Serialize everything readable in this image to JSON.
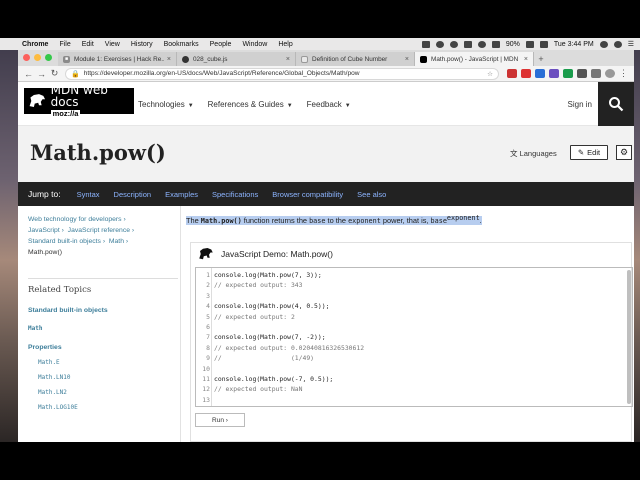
{
  "menubar": {
    "app": "Chrome",
    "items": [
      "File",
      "Edit",
      "View",
      "History",
      "Bookmarks",
      "People",
      "Window",
      "Help"
    ],
    "battery": "90%",
    "clock": "Tue 3:44 PM"
  },
  "tabs": [
    {
      "title": "Module 1: Exercises | Hack Re...",
      "icon": "hackreactor-icon"
    },
    {
      "title": "028_cube.js",
      "icon": "github-icon"
    },
    {
      "title": "Definition of Cube Number",
      "icon": "page-icon"
    },
    {
      "title": "Math.pow() - JavaScript | MDN",
      "icon": "mdn-icon"
    }
  ],
  "address": {
    "url": "https://developer.mozilla.org/en-US/docs/Web/JavaScript/Reference/Global_Objects/Math/pow"
  },
  "header": {
    "logo_line1": "MDN web docs",
    "logo_line2": "moz://a",
    "nav": [
      "Technologies",
      "References & Guides",
      "Feedback"
    ],
    "signin": "Sign in"
  },
  "title": {
    "h1": "Math.pow()",
    "languages": "Languages",
    "edit": "Edit"
  },
  "jump": {
    "label": "Jump to:",
    "items": [
      "Syntax",
      "Description",
      "Examples",
      "Specifications",
      "Browser compatibility",
      "See also"
    ]
  },
  "sidebar": {
    "breadcrumbs": [
      "Web technology for developers",
      "JavaScript",
      "JavaScript reference",
      "Standard built-in objects",
      "Math",
      "Math.pow()"
    ],
    "related": "Related Topics",
    "std": "Standard built-in objects",
    "math": "Math",
    "properties": "Properties",
    "props": [
      "Math.E",
      "Math.LN10",
      "Math.LN2",
      "Math.LOG10E"
    ]
  },
  "article": {
    "intro_1": "The ",
    "intro_fn": "Math.pow()",
    "intro_2": " function returns the ",
    "intro_base": "base",
    "intro_3": " to the ",
    "intro_exp": "exponent",
    "intro_4": " power, that is, ",
    "intro_base2": "base",
    "intro_sup": "exponent",
    "intro_5": "."
  },
  "demo": {
    "title": "JavaScript Demo: Math.pow()",
    "run": "Run ›",
    "lines": [
      "console.log(Math.pow(7, 3));",
      "// expected output: 343",
      "",
      "console.log(Math.pow(4, 0.5));",
      "// expected output: 2",
      "",
      "console.log(Math.pow(7, -2));",
      "// expected output: 0.02040816326530612",
      "//                  (1/49)",
      "",
      "console.log(Math.pow(-7, 0.5));",
      "// expected output: NaN",
      ""
    ]
  },
  "colors": {
    "link": "#3d7e9a",
    "jumplink": "#8cb4ff",
    "highlight": "#b7cdef"
  }
}
